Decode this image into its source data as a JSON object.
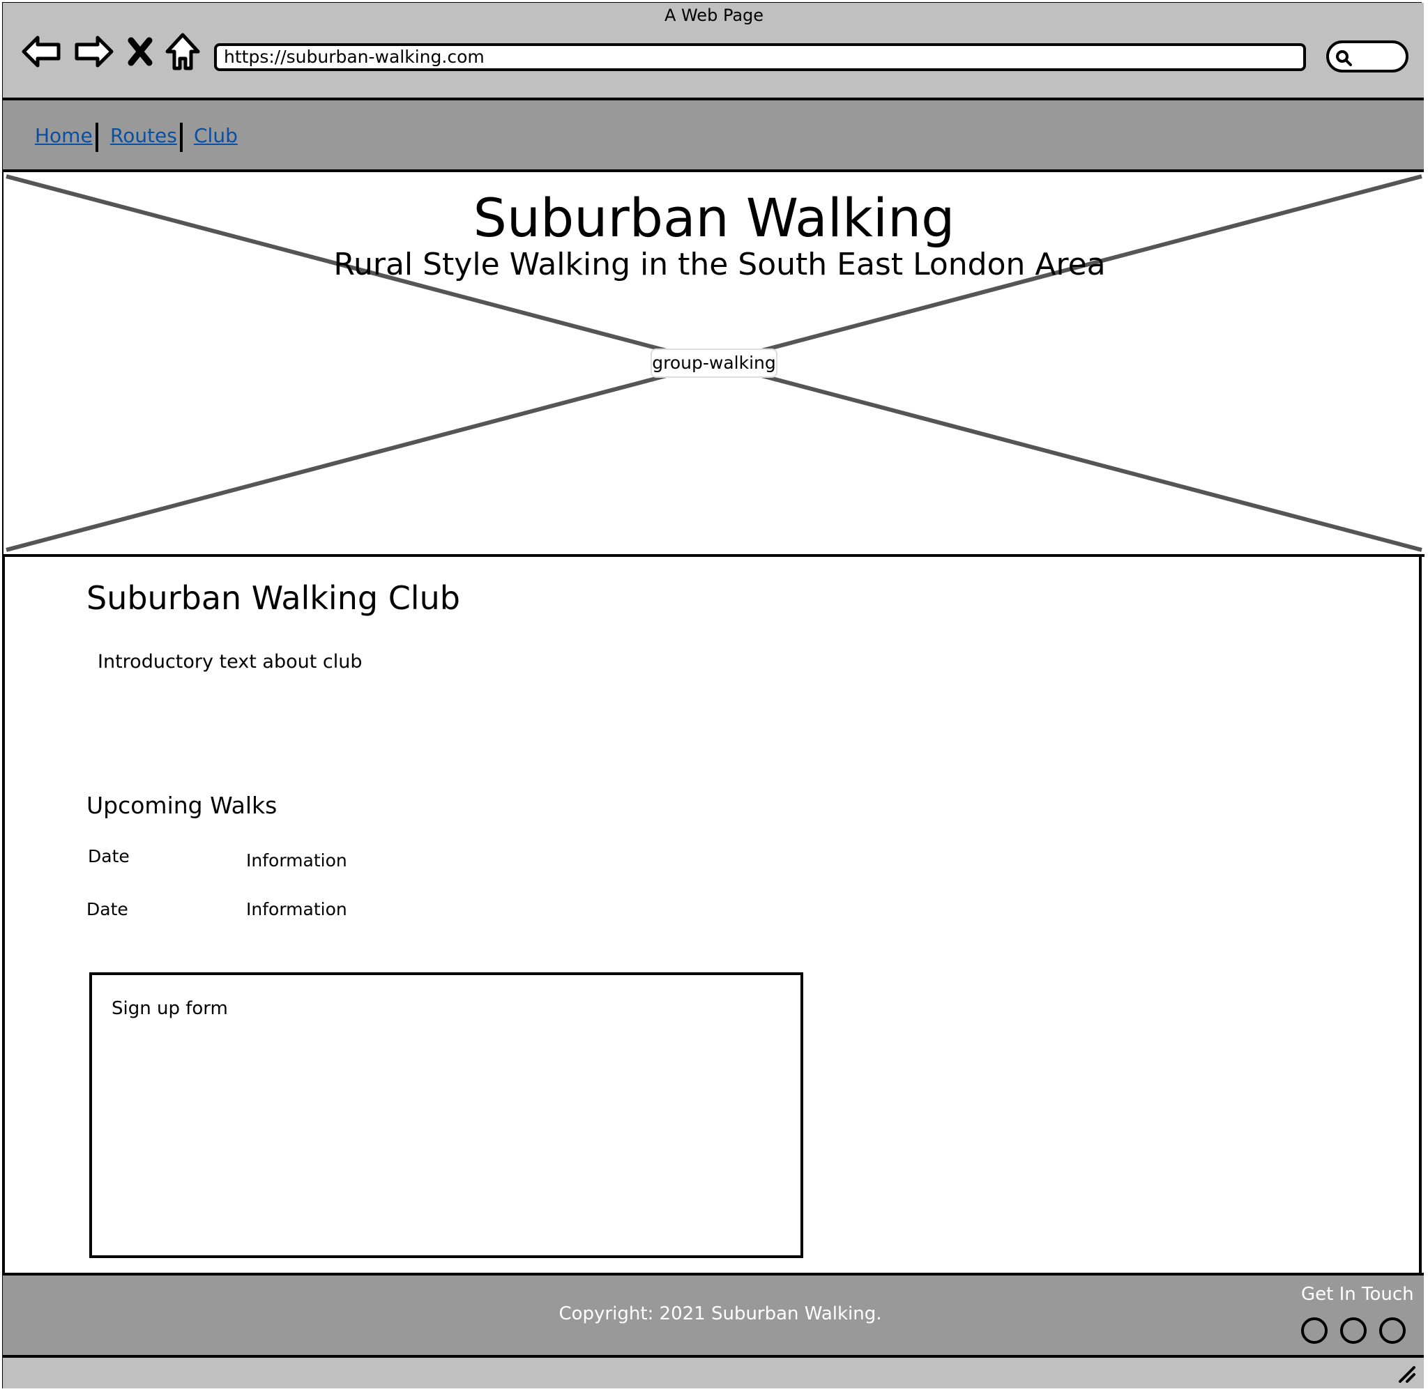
{
  "browser": {
    "window_title": "A Web Page",
    "url": "https://suburban-walking.com",
    "nav_icons": [
      "back-arrow-icon",
      "forward-arrow-icon",
      "stop-icon",
      "home-icon"
    ]
  },
  "site_nav": {
    "links": [
      "Home",
      "Routes",
      "Club"
    ],
    "link_color": "#0b4fa3",
    "bar_color": "#999999"
  },
  "hero": {
    "title": "Suburban Walking",
    "subtitle": "Rural Style Walking in the South East London Area",
    "image_label": "group-walking"
  },
  "main": {
    "club_heading": "Suburban Walking Club",
    "intro_text": "Introductory text about club",
    "upcoming_heading": "Upcoming Walks",
    "walks": [
      {
        "date": "Date",
        "info": "Information"
      },
      {
        "date": "Date",
        "info": "Information"
      }
    ],
    "signup_label": "Sign up form"
  },
  "footer": {
    "copyright": "Copyright: 2021 Suburban Walking.",
    "get_in_touch": "Get In Touch",
    "social_icons": [
      "social-circle-icon",
      "social-circle-icon",
      "social-circle-icon"
    ]
  }
}
